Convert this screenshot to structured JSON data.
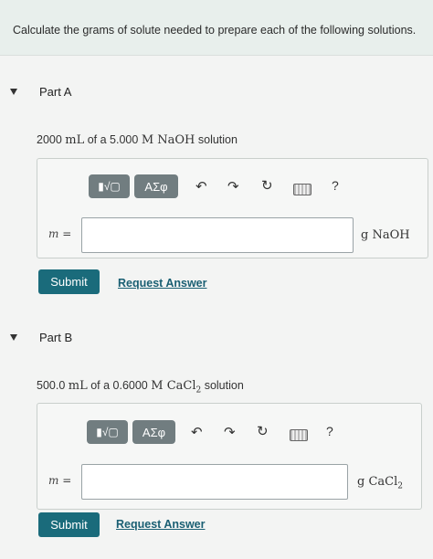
{
  "prompt": "Calculate the grams of solute needed to prepare each of the following solutions.",
  "toolbar": {
    "templates_icon": "template-icon",
    "symbols_label": "ΑΣφ",
    "undo_icon": "undo-icon",
    "redo_icon": "redo-icon",
    "reset_icon": "reset-icon",
    "keyboard_icon": "keyboard-icon",
    "help_label": "?"
  },
  "parts": [
    {
      "title": "Part A",
      "question_pre": "2000 ",
      "question_unit": "mL",
      "question_mid": " of a 5.000 ",
      "question_formula": "M NaOH",
      "question_post": " solution",
      "variable_label": "m =",
      "input_value": "",
      "unit": "g NaOH",
      "submit_label": "Submit",
      "request_label": "Request Answer"
    },
    {
      "title": "Part B",
      "question_pre": "500.0 ",
      "question_unit": "mL",
      "question_mid": " of a 0.6000 ",
      "question_formula": "M CaCl",
      "question_sub": "2",
      "question_post": " solution",
      "variable_label": "m =",
      "input_value": "",
      "unit": "g CaCl",
      "unit_sub": "2",
      "submit_label": "Submit",
      "request_label": "Request Answer"
    }
  ]
}
